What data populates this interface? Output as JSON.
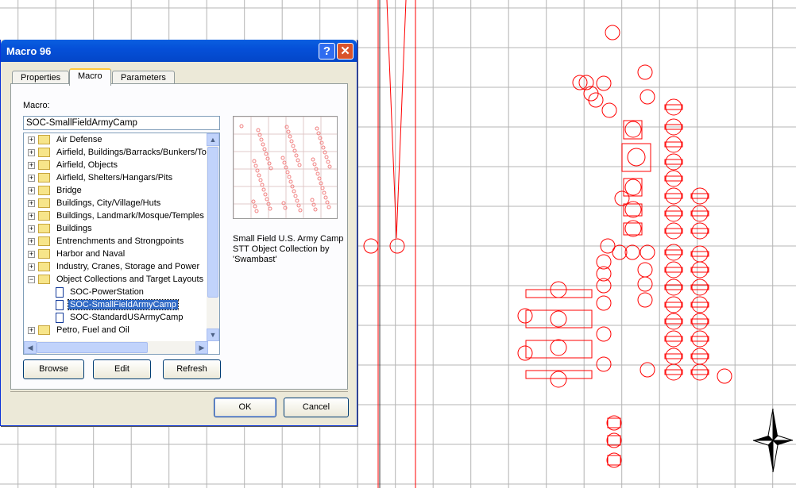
{
  "dialog": {
    "title": "Macro 96",
    "help_label": "?",
    "close_label": "✕",
    "tabs": [
      {
        "label": "Properties"
      },
      {
        "label": "Macro",
        "selected": true
      },
      {
        "label": "Parameters"
      }
    ],
    "macro_label": "Macro:",
    "macro_value": "SOC-SmallFieldArmyCamp",
    "tree": [
      {
        "label": "Air Defense",
        "type": "folder",
        "expander": "+"
      },
      {
        "label": "Airfield, Buildings/Barracks/Bunkers/Towers",
        "type": "folder",
        "expander": "+"
      },
      {
        "label": "Airfield, Objects",
        "type": "folder",
        "expander": "+"
      },
      {
        "label": "Airfield, Shelters/Hangars/Pits",
        "type": "folder",
        "expander": "+"
      },
      {
        "label": "Bridge",
        "type": "folder",
        "expander": "+"
      },
      {
        "label": "Buildings, City/Village/Huts",
        "type": "folder",
        "expander": "+"
      },
      {
        "label": "Buildings, Landmark/Mosque/Temples",
        "type": "folder",
        "expander": "+"
      },
      {
        "label": "Buildings",
        "type": "folder",
        "expander": "+"
      },
      {
        "label": "Entrenchments and Strongpoints",
        "type": "folder",
        "expander": "+"
      },
      {
        "label": "Harbor and Naval",
        "type": "folder",
        "expander": "+"
      },
      {
        "label": "Industry, Cranes, Storage and Power",
        "type": "folder",
        "expander": "+"
      },
      {
        "label": "Object Collections and Target Layouts",
        "type": "folder",
        "expander": "−"
      },
      {
        "label": "SOC-PowerStation",
        "type": "doc"
      },
      {
        "label": "SOC-SmallFieldArmyCamp",
        "type": "doc",
        "selected": true
      },
      {
        "label": "SOC-StandardUSArmyCamp",
        "type": "doc"
      },
      {
        "label": "Petro, Fuel and Oil",
        "type": "folder",
        "expander": "+"
      }
    ],
    "description": "Small Field U.S. Army Camp STT Object Collection by 'Swambast'",
    "buttons": {
      "browse": "Browse",
      "edit": "Edit",
      "refresh": "Refresh",
      "ok": "OK",
      "cancel": "Cancel"
    }
  },
  "colors": {
    "object_stroke": "#ff0000",
    "grid": "#b4b4b4",
    "title_bar": "#0550d8",
    "selection": "#316ac5"
  },
  "icons": {
    "compass": "north-star-compass-icon",
    "folder": "folder-icon",
    "document": "document-icon"
  }
}
